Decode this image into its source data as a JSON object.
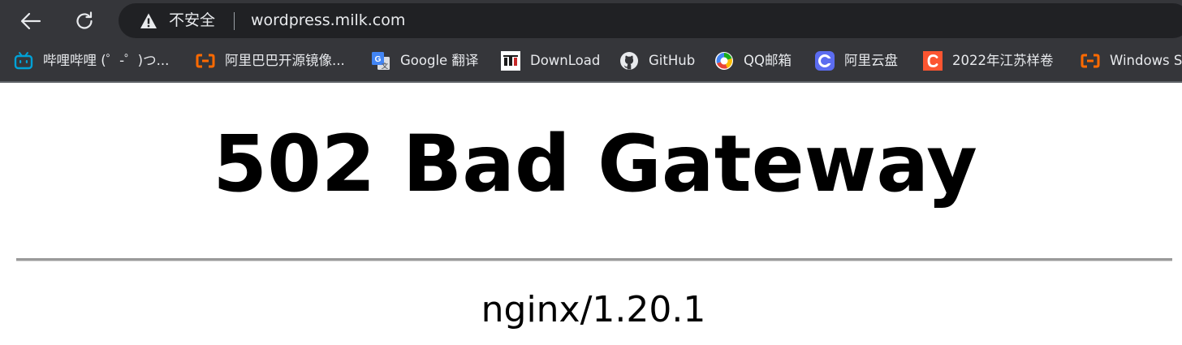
{
  "browser": {
    "security_label": "不安全",
    "url": "wordpress.milk.com"
  },
  "bookmarks": [
    {
      "label": "哔哩哔哩 (゜-゜)つ...",
      "icon": "bilibili-icon"
    },
    {
      "label": "阿里巴巴开源镜像...",
      "icon": "alibaba-cloud-icon"
    },
    {
      "label": "Google 翻译",
      "icon": "google-translate-icon"
    },
    {
      "label": "DownLoad",
      "icon": "download-site-icon"
    },
    {
      "label": "GitHub",
      "icon": "github-icon"
    },
    {
      "label": "QQ邮箱",
      "icon": "qq-mail-icon"
    },
    {
      "label": "阿里云盘",
      "icon": "aliyun-drive-icon"
    },
    {
      "label": "2022年江苏样卷",
      "icon": "csdn-icon"
    },
    {
      "label": "Windows Se",
      "icon": "alibaba-cloud-icon"
    }
  ],
  "page": {
    "title": "502 Bad Gateway",
    "server": "nginx/1.20.1"
  },
  "colors": {
    "chrome_frame": "#35363a",
    "omnibox": "#202124",
    "text_light": "#e8eaed",
    "alibaba_orange": "#ff6a00",
    "bilibili_blue": "#00a1d6",
    "csdn_red": "#fc5531"
  }
}
